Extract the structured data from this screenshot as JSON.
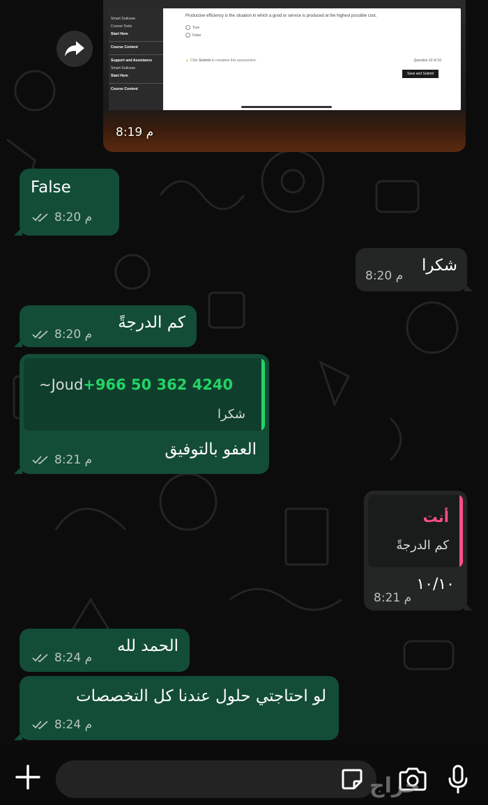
{
  "image_message": {
    "time": "8:19 م",
    "screen": {
      "nav_items": [
        "Smart Suitcase",
        "Course Tools",
        "Start Here",
        "Course Content",
        "Support and Assistance",
        "Smart Suitcase",
        "Start Here",
        "Course Content"
      ],
      "question": "Productive efficiency is the situation in which a good or service is produced at the highest possible cost.",
      "option_true": "True",
      "option_false": "False",
      "hint_prefix": "Click ",
      "hint_bold": "Submit",
      "hint_suffix": " to complete this assessment.",
      "question_count": "Question 10 of 10",
      "submit_label": "Save and Submit"
    }
  },
  "messages": [
    {
      "id": "m1",
      "text": "False",
      "time": "8:20 م"
    },
    {
      "id": "m2",
      "text": "شكرا",
      "time": "8:20 م"
    },
    {
      "id": "m3",
      "text": "كم الدرجةً",
      "time": "8:20 م"
    },
    {
      "id": "m4",
      "quote_author": "~Joud",
      "quote_phone": "+966 50 362 4240",
      "quote_text": "شكرا",
      "text": "العفو بالتوفيق",
      "time": "8:21 م"
    },
    {
      "id": "m5",
      "quote_author": "أنت",
      "quote_text": "كم الدرجةً",
      "text": "١٠/١٠",
      "time": "8:21 م"
    },
    {
      "id": "m6",
      "text": "الحمد لله",
      "time": "8:24 م"
    },
    {
      "id": "m7",
      "text": "لو احتاجتي حلول عندنا كل التخصصات",
      "time": "8:24 م"
    }
  ],
  "input": {
    "placeholder": ""
  },
  "watermark": "حراج",
  "colors": {
    "outgoing": "#134d37",
    "incoming": "#242626",
    "phone_green": "#25d366",
    "you_pink": "#ff4f8b"
  },
  "icons": [
    "forward-icon",
    "double-check-icon",
    "plus-icon",
    "sticker-icon",
    "camera-icon",
    "mic-icon"
  ]
}
